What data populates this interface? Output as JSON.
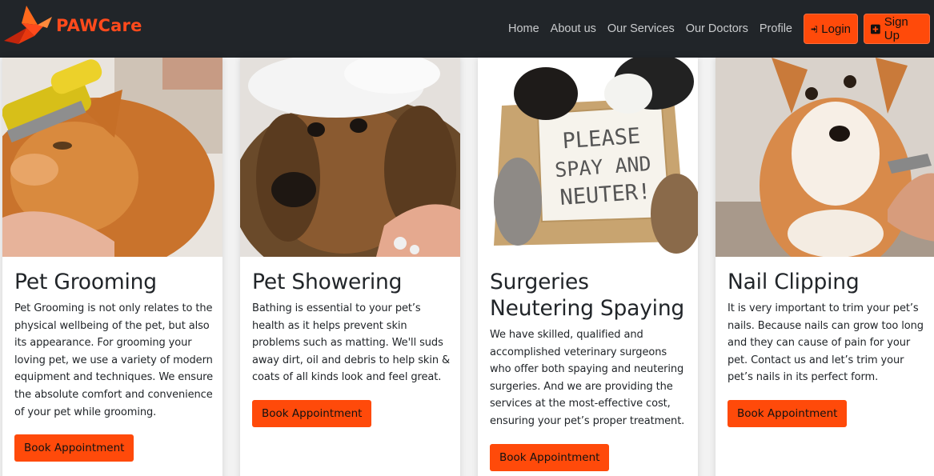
{
  "brand": {
    "paw": "PAW",
    "care": "Care"
  },
  "nav": {
    "links": [
      "Home",
      "About us",
      "Our Services",
      "Our Doctors",
      "Profile"
    ],
    "login_label": "Login",
    "signup_label": "Sign Up"
  },
  "colors": {
    "accent": "#ff4a0a",
    "navbar": "#212529"
  },
  "services": [
    {
      "title": "Pet Grooming",
      "text": "Pet Grooming is not only relates to the physical wellbeing of the pet, but also its appearance. For grooming your loving pet, we use a variety of modern equipment and techniques. We ensure the absolute comfort and convenience of your pet while grooming.",
      "button": "Book Appointment",
      "image_icon": "cat-brush-photo"
    },
    {
      "title": "Pet Showering",
      "text": "Bathing is essential to your pet’s health as it helps prevent skin problems such as matting. We'll suds away dirt, oil and debris to help skin & coats of all kinds look and feel great.",
      "button": "Book Appointment",
      "image_icon": "dog-bath-photo"
    },
    {
      "title": "Surgeries Neutering Spaying",
      "text": "We have skilled, qualified and accomplished veterinary surgeons who offer both spaying and neutering surgeries. And we are providing the services at the most-effective cost, ensuring your pet’s proper treatment.",
      "button": "Book Appointment",
      "image_icon": "puppies-kittens-photo",
      "sign_lines": [
        "PLEASE",
        "SPAY AND",
        "NEUTER!"
      ]
    },
    {
      "title": "Nail Clipping",
      "text": "It is very important to trim your pet’s nails. Because nails can grow too long and they can cause of pain for your pet. Contact us and let’s trim your pet’s nails in its perfect form.",
      "button": "Book Appointment",
      "image_icon": "corgi-nail-photo"
    }
  ]
}
